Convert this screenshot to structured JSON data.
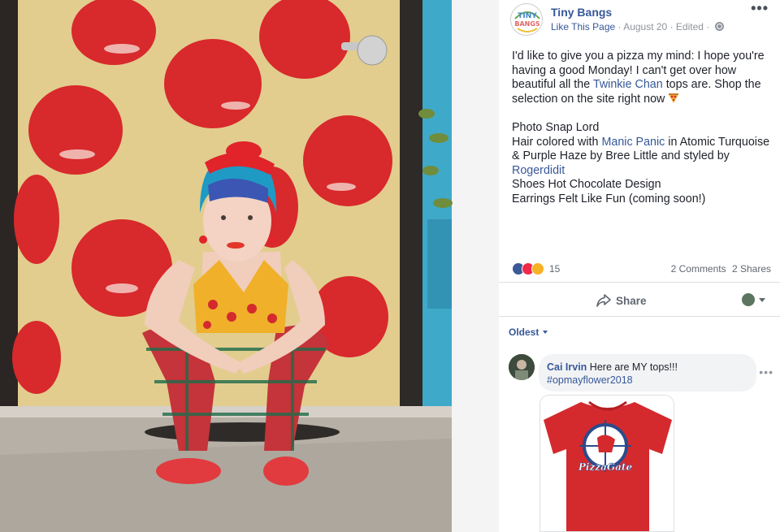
{
  "post": {
    "page_name": "Tiny Bangs",
    "avatar_text": "TINY BANGS",
    "like_page": "Like This Page",
    "sep1": " · ",
    "date": "August 20",
    "sep2": " · ",
    "edited": "Edited",
    "sep3": " · ",
    "text": {
      "line1_a": "I'd like to give you a pizza my mind: I hope you're having a good Monday! I can't get over how beautiful all the ",
      "line1_link": "Twinkie Chan",
      "line1_b": " tops are. Shop the selection on the site right now ",
      "line2": "Photo Snap Lord",
      "line3_a": "Hair colored with ",
      "line3_link": "Manic Panic",
      "line3_b": " in Atomic Turquoise & Purple Haze by Bree Little and styled by ",
      "line3_link2": "Rogerdidit",
      "line4": "Shoes Hot Chocolate Design",
      "line5": "Earrings Felt Like Fun (coming soon!)"
    },
    "reactions_count": "15",
    "comments": "2 Comments",
    "shares": "2 Shares",
    "share_label": "Share",
    "sort_label": "Oldest"
  },
  "comment": {
    "author": "Cai Irvin",
    "text": " Here are MY tops!!! ",
    "hashtag": "#opmayflower2018",
    "shirt_text": "PizzaGate"
  },
  "colors": {
    "link": "#365899",
    "meta": "#90949c",
    "shirt": "#d42a2e"
  }
}
